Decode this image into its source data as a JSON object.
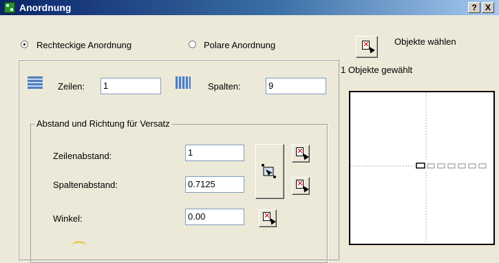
{
  "window": {
    "title": "Anordnung",
    "help_label": "?",
    "close_label": "X"
  },
  "mode": {
    "rect_label": "Rechteckige Anordnung",
    "polar_label": "Polare Anordnung",
    "selected": "rect"
  },
  "select": {
    "button_label": "Objekte wählen",
    "status": "1 Objekte gewählt"
  },
  "grid": {
    "rows_label": "Zeilen:",
    "rows_value": "1",
    "cols_label": "Spalten:",
    "cols_value": "9"
  },
  "offset": {
    "group_label": "Abstand und Richtung für Versatz",
    "row_spacing_label": "Zeilenabstand:",
    "row_spacing_value": "1",
    "col_spacing_label": "Spaltenabstand:",
    "col_spacing_value": "0.7125",
    "angle_label": "Winkel:",
    "angle_value": "0.00"
  },
  "icons": {
    "app": "app-icon",
    "rows": "rows-icon",
    "columns": "columns-icon",
    "pick": "pick-point-icon",
    "pick_both": "pick-both-offsets-icon"
  },
  "colors": {
    "title_start": "#0a246a",
    "title_end": "#a6caf0",
    "dialog_bg": "#ece9d8",
    "pick_x": "#d00000"
  }
}
